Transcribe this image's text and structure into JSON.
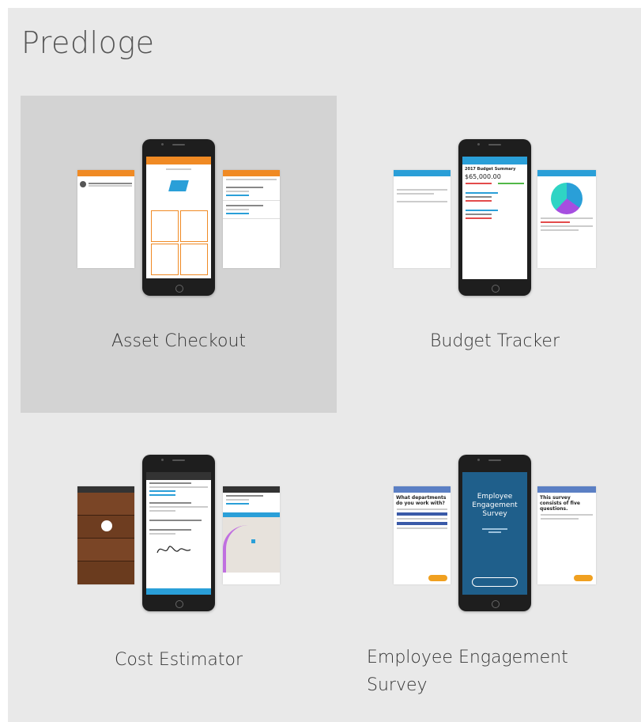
{
  "page": {
    "title": "Predloge"
  },
  "templates": [
    {
      "id": "asset-checkout",
      "label": "Asset Checkout",
      "selected": true,
      "accent": "#f08a24",
      "phone_header": "Asset Checkout"
    },
    {
      "id": "budget-tracker",
      "label": "Budget Tracker",
      "selected": false,
      "accent": "#2a9fd8",
      "phone_header": "Budget Tracker",
      "screen_heading": "2017 Budget Summary",
      "screen_amount": "$65,000.00"
    },
    {
      "id": "cost-estimator",
      "label": "Cost Estimator",
      "selected": false,
      "accent": "#2a9fd8"
    },
    {
      "id": "employee-engagement-survey",
      "label": "Employee Engagement Survey",
      "label_lines": [
        "Employee Engagement",
        "Survey"
      ],
      "selected": false,
      "accent": "#5b7fc4",
      "screen_left_heading": "What departments do you work with?",
      "screen_center_heading": "Employee Engagement Survey",
      "screen_right_heading": "This survey consists of five questions."
    }
  ]
}
